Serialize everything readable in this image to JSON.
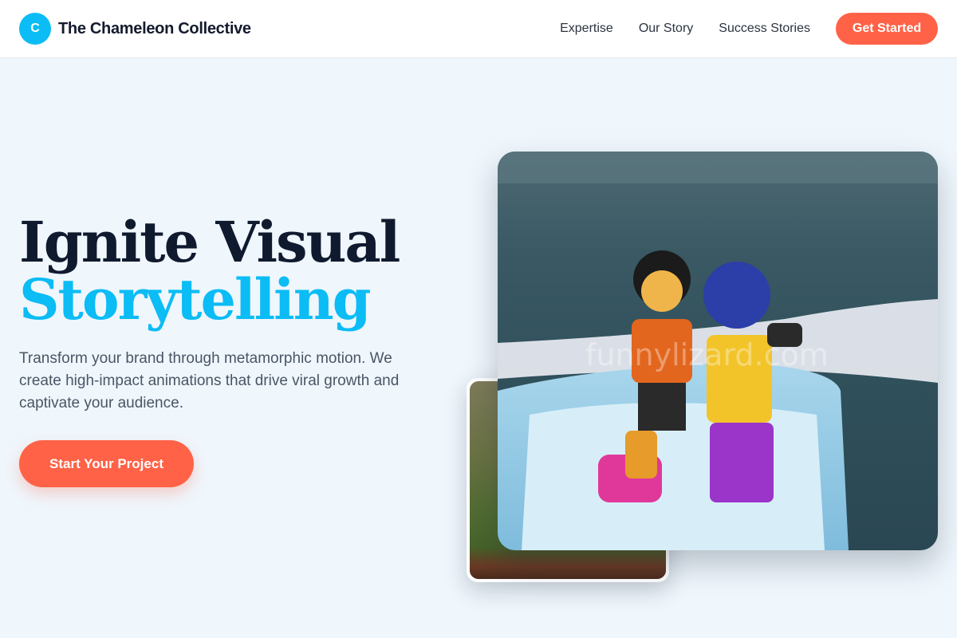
{
  "header": {
    "logo_letter": "C",
    "brand_name": "The Chameleon Collective",
    "nav": [
      "Expertise",
      "Our Story",
      "Success Stories"
    ],
    "cta_label": "Get Started"
  },
  "hero": {
    "title_line1": "Ignite Visual",
    "title_line2": "Storytelling",
    "subtitle": "Transform your brand through metamorphic motion. We create high-impact animations that drive viral growth and captivate your audience.",
    "button_label": "Start Your Project"
  },
  "images": {
    "main_watermark": "funnylizard.com"
  },
  "colors": {
    "accent": "#0bbcf5",
    "cta": "#ff6246",
    "heading": "#101a2f",
    "background": "#eff6fc"
  }
}
